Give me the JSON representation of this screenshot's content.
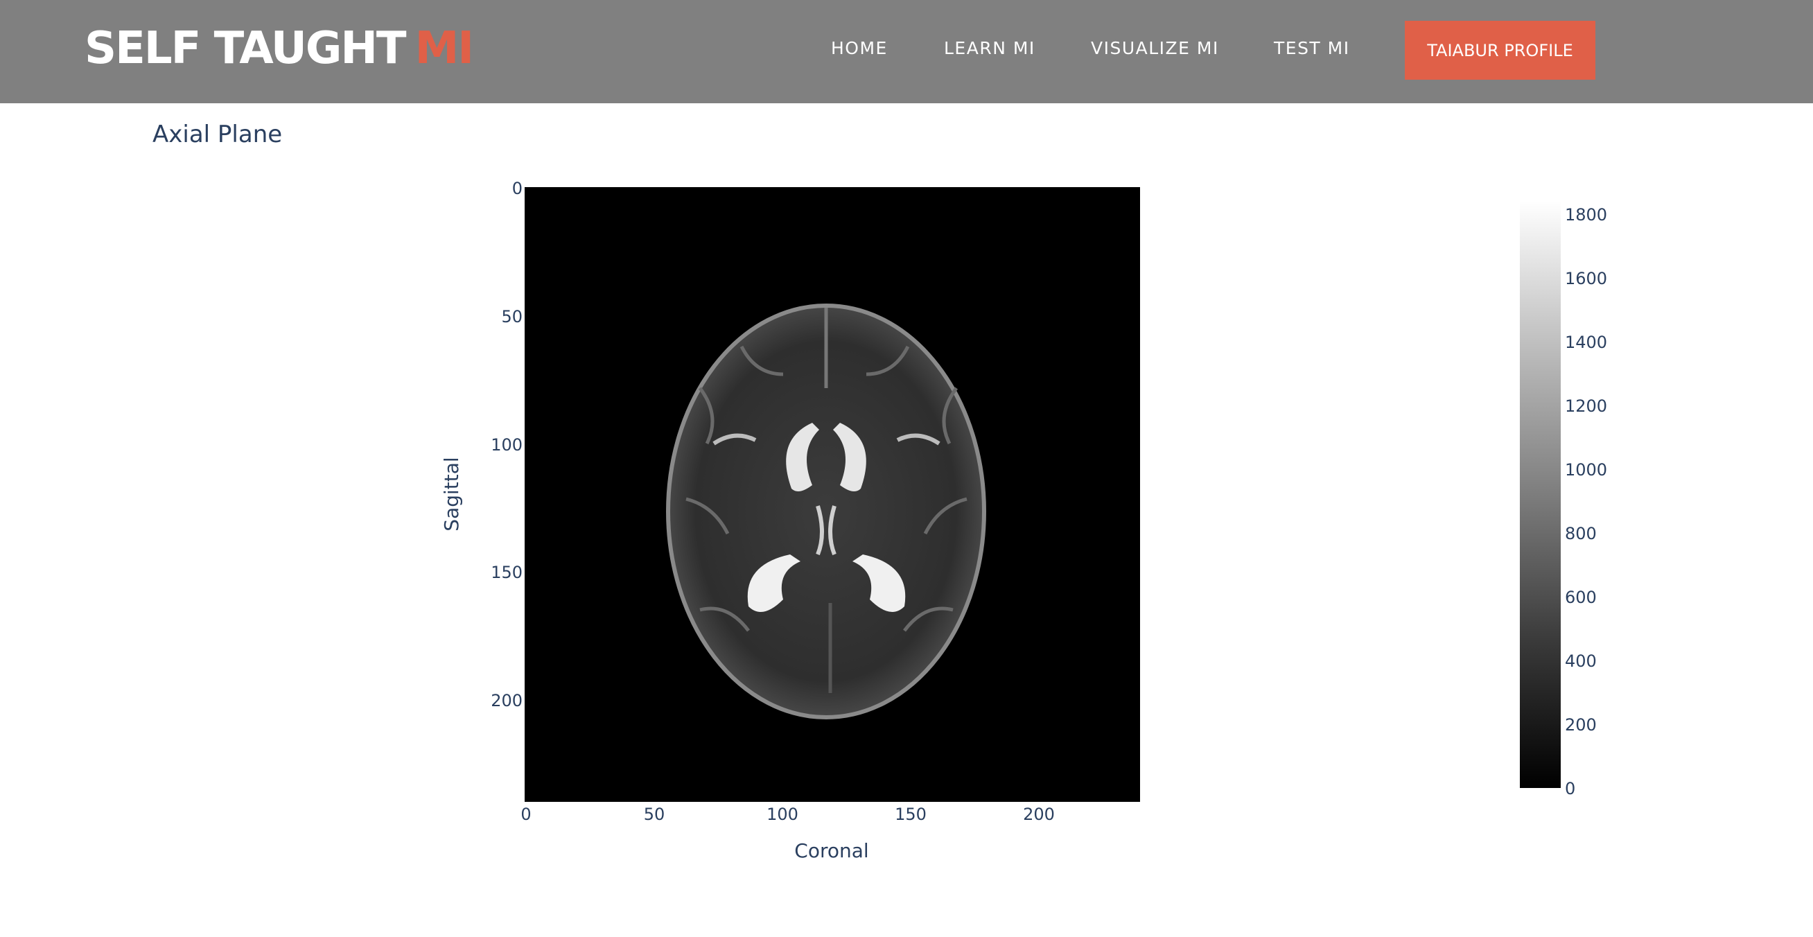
{
  "header": {
    "brand_main": "SELF TAUGHT",
    "brand_accent": "MI",
    "nav": [
      "HOME",
      "LEARN MI",
      "VISUALIZE MI",
      "TEST MI"
    ],
    "profile_button": "TAIABUR PROFILE",
    "colors": {
      "bar": "#808080",
      "accent": "#e06048"
    }
  },
  "page": {
    "section_title": "Axial Plane"
  },
  "chart_data": {
    "type": "heatmap",
    "title": "",
    "xlabel": "Coronal",
    "ylabel": "Sagittal",
    "xlim": [
      0,
      240
    ],
    "ylim": [
      0,
      240
    ],
    "y_reversed": true,
    "x_ticks": [
      0,
      50,
      100,
      150,
      200
    ],
    "y_ticks": [
      0,
      50,
      100,
      150,
      200
    ],
    "colorscale": "greys",
    "colorbar": {
      "range": [
        0,
        1850
      ],
      "ticks": [
        0,
        200,
        400,
        600,
        800,
        1000,
        1200,
        1400,
        1600,
        1800
      ]
    }
  }
}
